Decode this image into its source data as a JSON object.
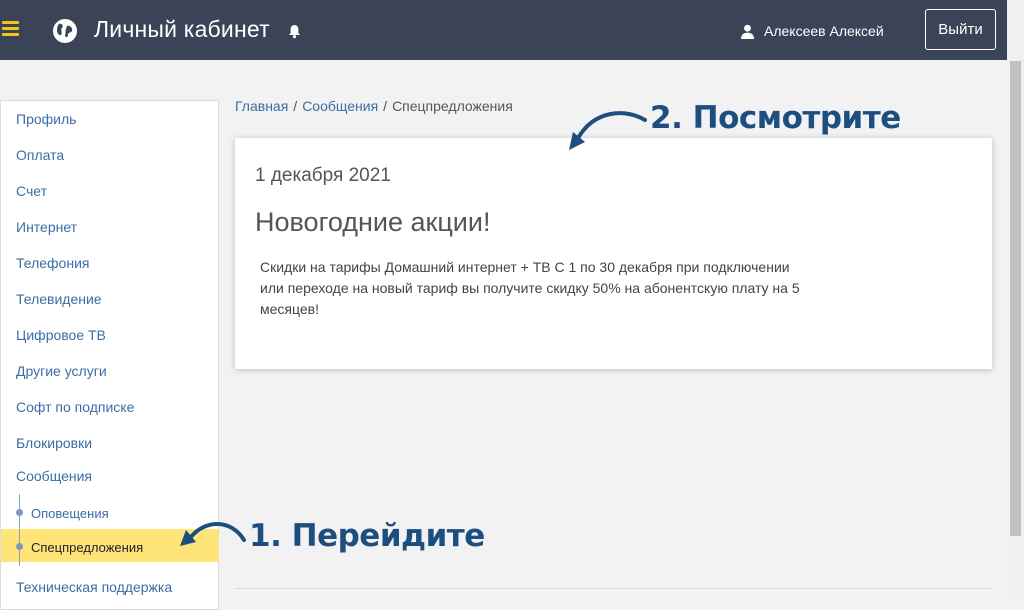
{
  "header": {
    "title": "Личный кабинет",
    "user_name": "Алексеев Алексей",
    "logout_label": "Выйти"
  },
  "sidebar": {
    "items": [
      {
        "label": "Профиль"
      },
      {
        "label": "Оплата"
      },
      {
        "label": "Счет"
      },
      {
        "label": "Интернет"
      },
      {
        "label": "Телефония"
      },
      {
        "label": "Телевидение"
      },
      {
        "label": "Цифровое ТВ"
      },
      {
        "label": "Другие услуги"
      },
      {
        "label": "Софт по подписке"
      },
      {
        "label": "Блокировки"
      },
      {
        "label": "Сообщения"
      }
    ],
    "subitems": [
      {
        "label": "Оповещения"
      },
      {
        "label": "Спецпредложения"
      }
    ],
    "bottom_item": "Техническая поддержка"
  },
  "breadcrumb": {
    "home": "Главная",
    "messages": "Сообщения",
    "current": "Спецпредложения",
    "separator": "/"
  },
  "card": {
    "date": "1 декабря 2021",
    "title": "Новогодние акции!",
    "body": "Скидки на тарифы Домашний интернет + ТВ С 1 по 30 декабря при подключении или переходе на новый тариф вы получите скидку 50% на абонентскую плату на 5 месяцев!"
  },
  "annotations": {
    "step1": "1. Перейдите",
    "step2": "2. Посмотрите"
  },
  "colors": {
    "header_bg": "#3b4456",
    "menu_accent": "#f5c518",
    "link": "#3a6ea5",
    "active_bg": "#ffe478",
    "annotation": "#1d4e80"
  },
  "icons": [
    "menu-icon",
    "globe-icon",
    "bell-icon",
    "user-icon",
    "arrow-icon"
  ]
}
